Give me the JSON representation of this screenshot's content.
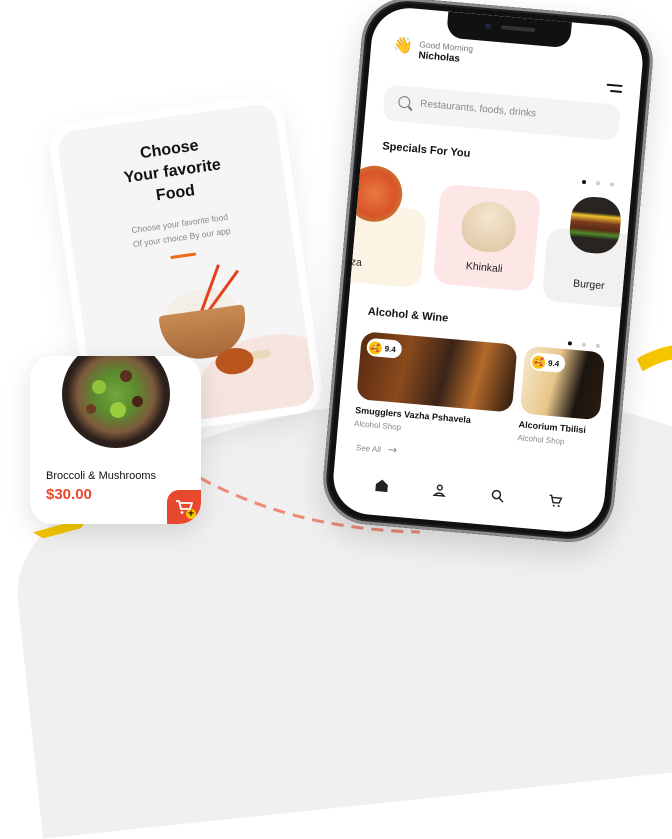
{
  "onboarding": {
    "title_lines": [
      "Choose",
      "Your favorite",
      "Food"
    ],
    "subtitle_lines": [
      "Choose your favorite food",
      "Of your choice By our app"
    ]
  },
  "product_card": {
    "name": "Broccoli & Mushrooms",
    "price": "$30.00",
    "cart_plus": "+",
    "icon": "add-to-cart-icon"
  },
  "app": {
    "greeting": "Good Morning",
    "user_name": "Nicholas",
    "greeting_emoji": "👋",
    "search": {
      "placeholder": "Restaurants, foods, drinks"
    },
    "specials": {
      "title": "Specials For You",
      "page_index": 0,
      "page_count": 3,
      "items": [
        {
          "label": "Pizza",
          "bg": "#fbf3e4"
        },
        {
          "label": "Khinkali",
          "bg": "#fde6e6"
        },
        {
          "label": "Burger",
          "bg": "#f1f1f1"
        }
      ]
    },
    "alcohol": {
      "title": "Alcohol & Wine",
      "page_index": 0,
      "page_count": 3,
      "items": [
        {
          "name": "Smugglers Vazha Pshavela",
          "type": "Alcohol Shop",
          "rating": "9.4",
          "emoji": "🥰"
        },
        {
          "name": "Alcorium Tbilisi",
          "type": "Alcohol Shop",
          "rating": "9.4",
          "emoji": "🥰"
        }
      ],
      "see_all": "See All"
    },
    "tabs": [
      {
        "name": "home",
        "active": true
      },
      {
        "name": "profile",
        "active": false
      },
      {
        "name": "search",
        "active": false
      },
      {
        "name": "cart",
        "active": false
      }
    ]
  },
  "colors": {
    "accent_red": "#e8492e",
    "accent_orange": "#f06a1a",
    "accent_yellow": "#f7c600"
  }
}
